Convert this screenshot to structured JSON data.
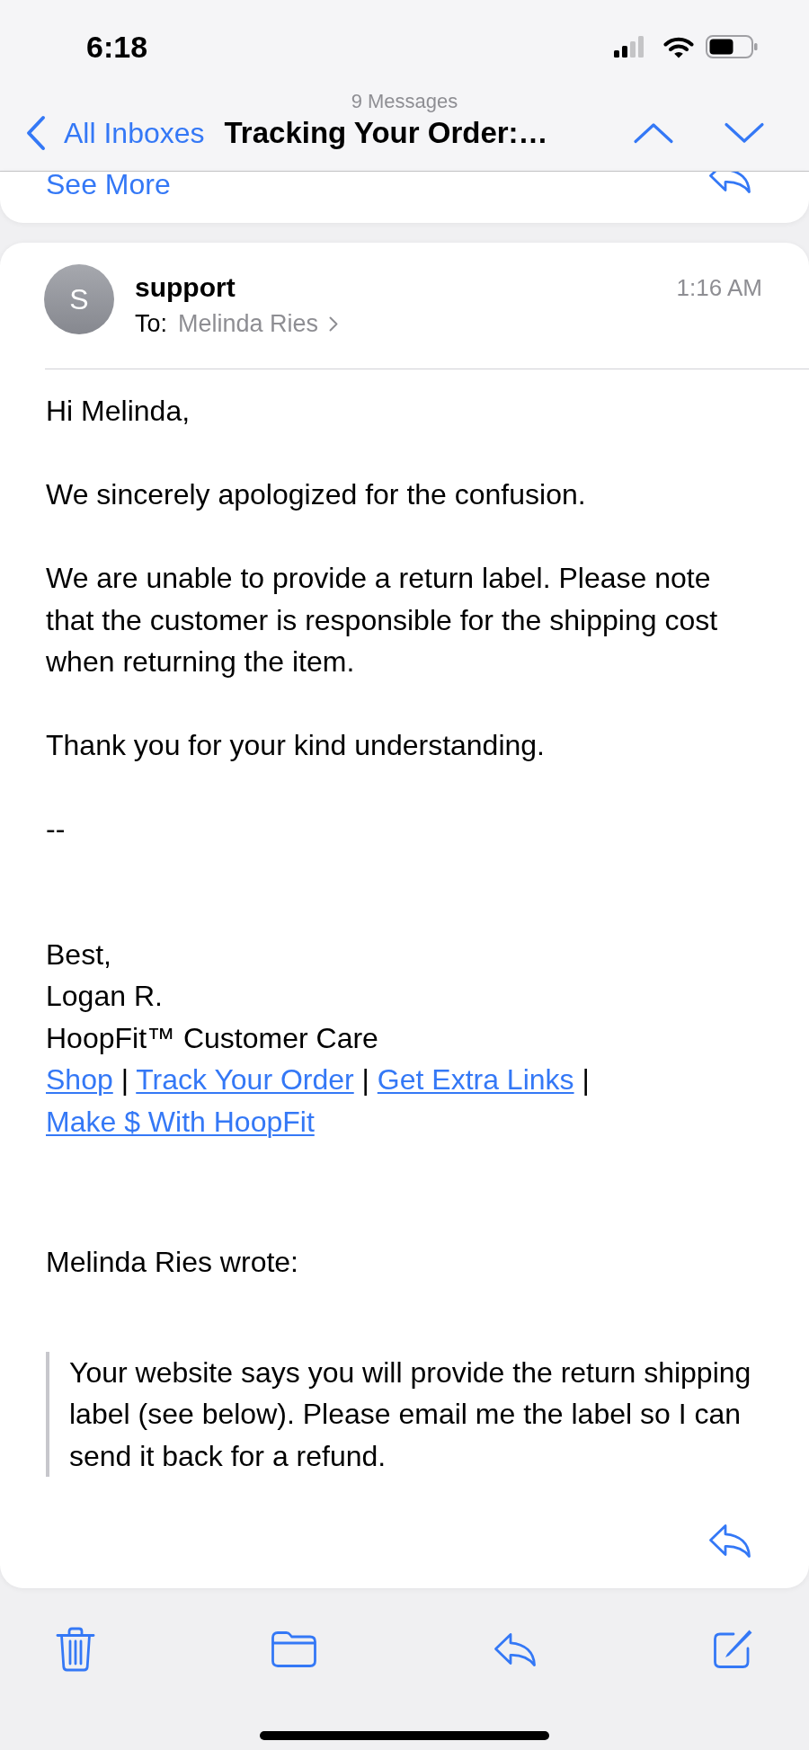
{
  "status_bar": {
    "time": "6:18"
  },
  "nav": {
    "subtitle": "9 Messages",
    "back_label": "All Inboxes",
    "title": "Tracking Your Order:…"
  },
  "previous_message": {
    "link": "See More"
  },
  "message": {
    "avatar_initial": "S",
    "sender": "support",
    "to_label": "To:",
    "recipient": "Melinda Ries",
    "time": "1:16 AM",
    "greeting": "Hi Melinda,",
    "paragraphs": [
      "We sincerely apologized for the confusion.",
      "We are unable to provide a return label. Please note that the customer is responsible for the shipping cost when returning the item.",
      "Thank you for your kind understanding."
    ],
    "signature_delimiter": "--",
    "signature_lines": [
      "Best,",
      "Logan R.",
      "HoopFit™ Customer Care"
    ],
    "signature_links": [
      {
        "kind": "link",
        "text": "Shop"
      },
      {
        "kind": "separator",
        "text": "|"
      },
      {
        "kind": "link",
        "text": "Track Your Order"
      },
      {
        "kind": "separator",
        "text": "|"
      },
      {
        "kind": "link",
        "text": "Get Extra Links"
      },
      {
        "kind": "separator",
        "text": "|"
      },
      {
        "kind": "link",
        "text": "Make $ With HoopFit"
      }
    ],
    "quote": {
      "attribution": "Melinda Ries wrote:",
      "text": "Your website says you will provide the return shipping label (see below). Please email me the label so I can send it back for a refund."
    }
  }
}
